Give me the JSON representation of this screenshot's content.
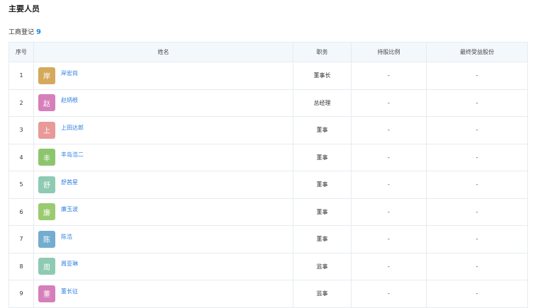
{
  "section_title": "主要人员",
  "registry": {
    "label": "工商登记",
    "count": "9"
  },
  "table": {
    "headers": [
      "序号",
      "姓名",
      "职务",
      "持股比例",
      "最终受益股份"
    ],
    "rows": [
      {
        "no": "1",
        "avatar": "岸",
        "avatar_color": "#d4a95c",
        "name": "岸宏尚",
        "position": "董事长",
        "share": "-",
        "benefit": "-"
      },
      {
        "no": "2",
        "avatar": "赵",
        "avatar_color": "#d67fbb",
        "name": "赵炳根",
        "position": "总经理",
        "share": "-",
        "benefit": "-"
      },
      {
        "no": "3",
        "avatar": "上",
        "avatar_color": "#e79a97",
        "name": "上田达郎",
        "position": "董事",
        "share": "-",
        "benefit": "-"
      },
      {
        "no": "4",
        "avatar": "丰",
        "avatar_color": "#8dc56f",
        "name": "丰岛浩二",
        "position": "董事",
        "share": "-",
        "benefit": "-"
      },
      {
        "no": "5",
        "avatar": "舒",
        "avatar_color": "#8fcab2",
        "name": "舒茜星",
        "position": "董事",
        "share": "-",
        "benefit": "-"
      },
      {
        "no": "6",
        "avatar": "廉",
        "avatar_color": "#9bcb70",
        "name": "廉玉波",
        "position": "董事",
        "share": "-",
        "benefit": "-"
      },
      {
        "no": "7",
        "avatar": "陈",
        "avatar_color": "#72adcf",
        "name": "陈浩",
        "position": "董事",
        "share": "-",
        "benefit": "-"
      },
      {
        "no": "8",
        "avatar": "周",
        "avatar_color": "#8fcab2",
        "name": "周亚琳",
        "position": "监事",
        "share": "-",
        "benefit": "-"
      },
      {
        "no": "9",
        "avatar": "董",
        "avatar_color": "#d67fbb",
        "name": "董长征",
        "position": "监事",
        "share": "-",
        "benefit": "-"
      }
    ]
  }
}
